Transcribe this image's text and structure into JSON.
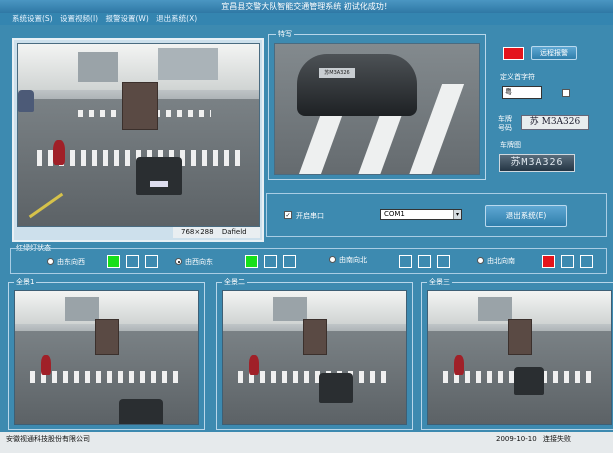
{
  "window": {
    "title": "宜昌县交警大队智能交通管理系统 初试化成功！"
  },
  "menu": [
    "系统设置(S)",
    "设置视频(I)",
    "报警设置(W)",
    "退出系统(X)"
  ],
  "main_video": {
    "resolution_label": "768×288",
    "mode_label": "Dafield"
  },
  "snapshot": {
    "group_title": "特写",
    "plate_in_image": "苏M3A326"
  },
  "right_panel": {
    "alarm_button": "远程报警",
    "mode_label": "定义首字符",
    "first_char_value": "粤",
    "plate_label_1": "车牌",
    "plate_label_2": "号码",
    "plate_number": "苏 M3A326",
    "plate_image_label": "车牌图",
    "plate_image_text": "苏M3A326"
  },
  "serial": {
    "open_port_label": "开启串口",
    "port_value": "COM1",
    "exit_button": "退出系统(E)"
  },
  "lights": {
    "group_title": "红绿灯状态",
    "directions": [
      {
        "label": "由东向西",
        "selected": false,
        "states": [
          "green",
          "off",
          "off"
        ]
      },
      {
        "label": "由西向东",
        "selected": true,
        "states": [
          "green",
          "off",
          "off"
        ]
      },
      {
        "label": "由南向北",
        "selected": false,
        "states": [
          "off",
          "off",
          "off"
        ]
      },
      {
        "label": "由北向南",
        "selected": false,
        "states": [
          "red",
          "off",
          "off"
        ]
      }
    ]
  },
  "cameras": [
    {
      "label": "全景1"
    },
    {
      "label": "全景二"
    },
    {
      "label": "全景三"
    }
  ],
  "status": {
    "company": "安徽视通科技股份有限公司",
    "date": "2009-10-10",
    "connection": "连接失败"
  },
  "colors": {
    "background": "#3d8ab0",
    "light_green": "#18e01a",
    "light_red": "#e4141c"
  }
}
